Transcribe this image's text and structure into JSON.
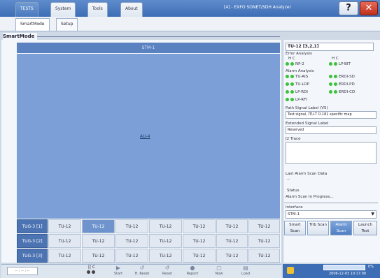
{
  "top_tabs": [
    {
      "label": "TESTS"
    },
    {
      "label": "System"
    },
    {
      "label": "Tools"
    },
    {
      "label": "About"
    }
  ],
  "app_title": "[4] - EXFO SONET/SDH Analyzer",
  "help_label": "?",
  "close_label": "✕",
  "sub_tabs": [
    {
      "label": "SmartMode"
    },
    {
      "label": "Setup"
    }
  ],
  "section_title": "SmartMode",
  "stm_label": "STM-1",
  "au_label": "AU-4",
  "grid": {
    "rows": [
      {
        "head": "TUG-3 [1]",
        "cells": [
          "TU-12",
          "TU-12",
          "TU-12",
          "TU-12",
          "TU-12",
          "TU-12",
          "TU-12"
        ]
      },
      {
        "head": "TUG-3 [2]",
        "cells": [
          "TU-12",
          "TU-12",
          "TU-12",
          "TU-12",
          "TU-12",
          "TU-12",
          "TU-12"
        ]
      },
      {
        "head": "TUG-3 [3]",
        "cells": [
          "TU-12",
          "TU-12",
          "TU-12",
          "TU-12",
          "TU-12",
          "TU-12",
          "TU-12"
        ]
      }
    ]
  },
  "toolbar": {
    "left_field": "-- : -- : --",
    "pause_label": "|| C",
    "buttons": [
      "Start",
      "H. Reset",
      "Reset",
      "Report",
      "Now",
      "Load"
    ]
  },
  "right": {
    "tu_header": "TU-12 [3,2,1]",
    "error_title": "Error Analysis",
    "error_hc1": "H C",
    "error_hc2": "H C",
    "error_items": [
      "NP-2",
      "LP-BIT"
    ],
    "alarm_title": "Alarm Analysis",
    "alarm_items": [
      "TU-AIS",
      "ERDI-SD",
      "TU-LOP",
      "ERDI-PD",
      "LP-RDI",
      "ERDI-CD",
      "LP-RFI"
    ],
    "path_label_title": "Path Signal Label (V5)",
    "path_label_value": "Test signal, ITU-T O.181 specific map",
    "ext_label_title": "Extended Signal Label",
    "ext_label_value": "Reserved",
    "j2_title": "J2 Trace",
    "last_scan_title": "Last Alarm Scan Data",
    "last_scan_value": "--",
    "status_title": "Status",
    "status_value": "Alarm Scan In Progress...",
    "interface_title": "Interface",
    "interface_value": "STM-1",
    "buttons": [
      "Smart Scan",
      "Trib Scan",
      "Alarm Scan",
      "Launch Test"
    ],
    "clock": "2006-12-03 10:17:00",
    "batt_label": "0%"
  },
  "colors": {
    "accent": "#3d6db5",
    "led_green": "#3bc23b",
    "highlight": "#6f93cc"
  }
}
